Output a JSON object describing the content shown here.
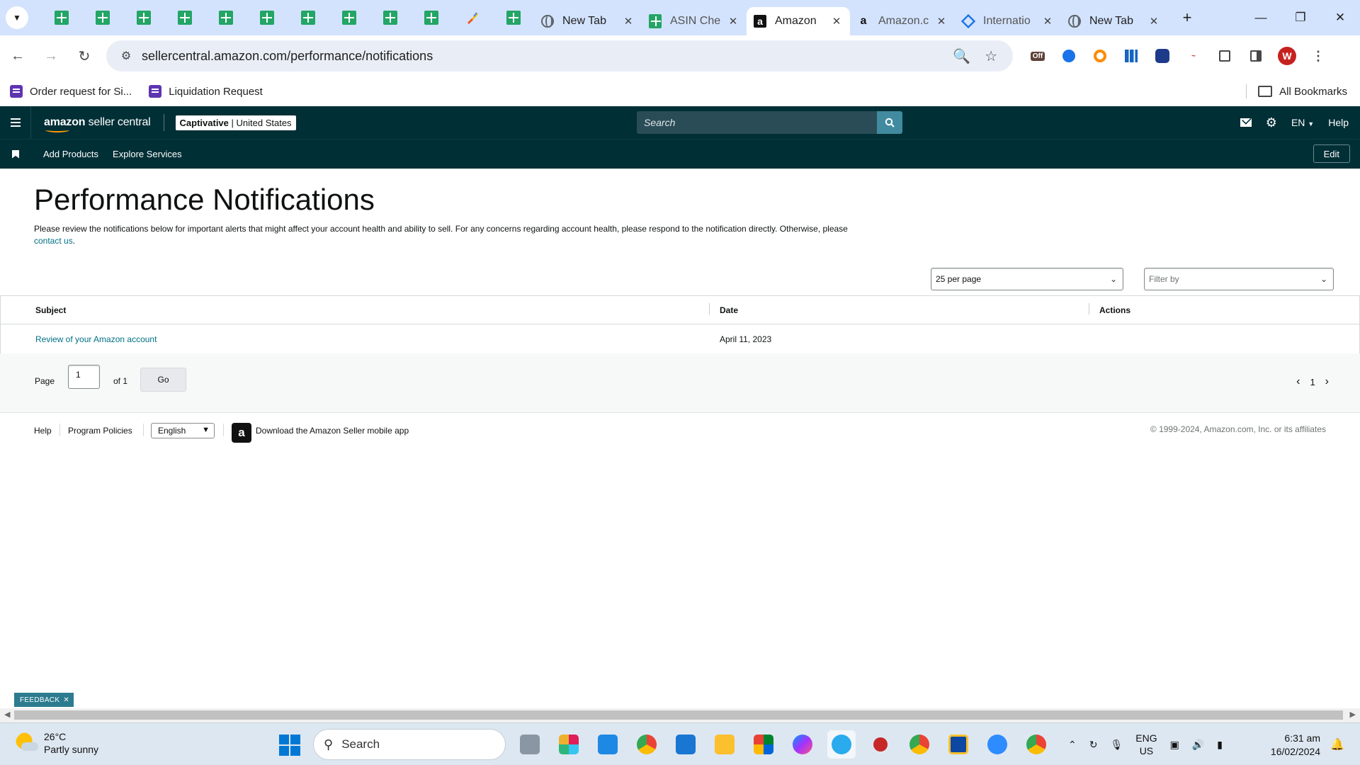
{
  "browser": {
    "tabs": [
      {
        "title": "New Tab",
        "icon": "globe-icon"
      },
      {
        "title": "ASIN Che",
        "icon": "sheets-icon"
      },
      {
        "title": "Amazon",
        "icon": "amazon-icon",
        "active": true
      },
      {
        "title": "Amazon.c",
        "icon": "amazon-icon"
      },
      {
        "title": "Internatio",
        "icon": "intl-icon"
      },
      {
        "title": "New Tab",
        "icon": "globe-icon"
      }
    ],
    "url": "sellercentral.amazon.com/performance/notifications",
    "bookmarks": [
      {
        "label": "Order request for Si..."
      },
      {
        "label": "Liquidation Request"
      }
    ],
    "all_bookmarks": "All Bookmarks",
    "profile_initial": "W",
    "ext_off_label": "Off"
  },
  "header": {
    "logo_bold": "amazon",
    "logo_light": " seller central",
    "account_name": "Captivative",
    "marketplace": "United States",
    "search_placeholder": "Search",
    "language": "EN",
    "help": "Help"
  },
  "subnav": {
    "links": [
      "Add Products",
      "Explore Services"
    ],
    "edit": "Edit"
  },
  "page": {
    "title": "Performance Notifications",
    "description": "Please review the notifications below for important alerts that might affect your account health and ability to sell. For any concerns regarding account health, please respond to the notification directly. Otherwise, please",
    "contact_link": "contact us",
    "description_end": ".",
    "per_page": "25 per page",
    "filter_placeholder": "Filter by"
  },
  "table": {
    "headers": {
      "subject": "Subject",
      "date": "Date",
      "actions": "Actions"
    },
    "rows": [
      {
        "subject": "Review of your Amazon account",
        "date": "April 11, 2023",
        "actions": ""
      }
    ]
  },
  "pagination": {
    "page_label": "Page",
    "current": "1",
    "of_label": "of 1",
    "go": "Go",
    "nav_page": "1"
  },
  "footer": {
    "help": "Help",
    "program_policies": "Program Policies",
    "language": "English",
    "mobile_app": "Download the Amazon Seller mobile app",
    "copyright": "© 1999-2024, Amazon.com, Inc. or its affiliates"
  },
  "feedback": "FEEDBACK",
  "taskbar": {
    "temperature": "26°C",
    "weather": "Partly sunny",
    "search": "Search",
    "lang_top": "ENG",
    "lang_bottom": "US",
    "time": "6:31 am",
    "date": "16/02/2024"
  },
  "colors": {
    "header_bg": "#002f36",
    "link": "#007185",
    "accent": "#ff9900",
    "search_button": "#418a9f"
  }
}
